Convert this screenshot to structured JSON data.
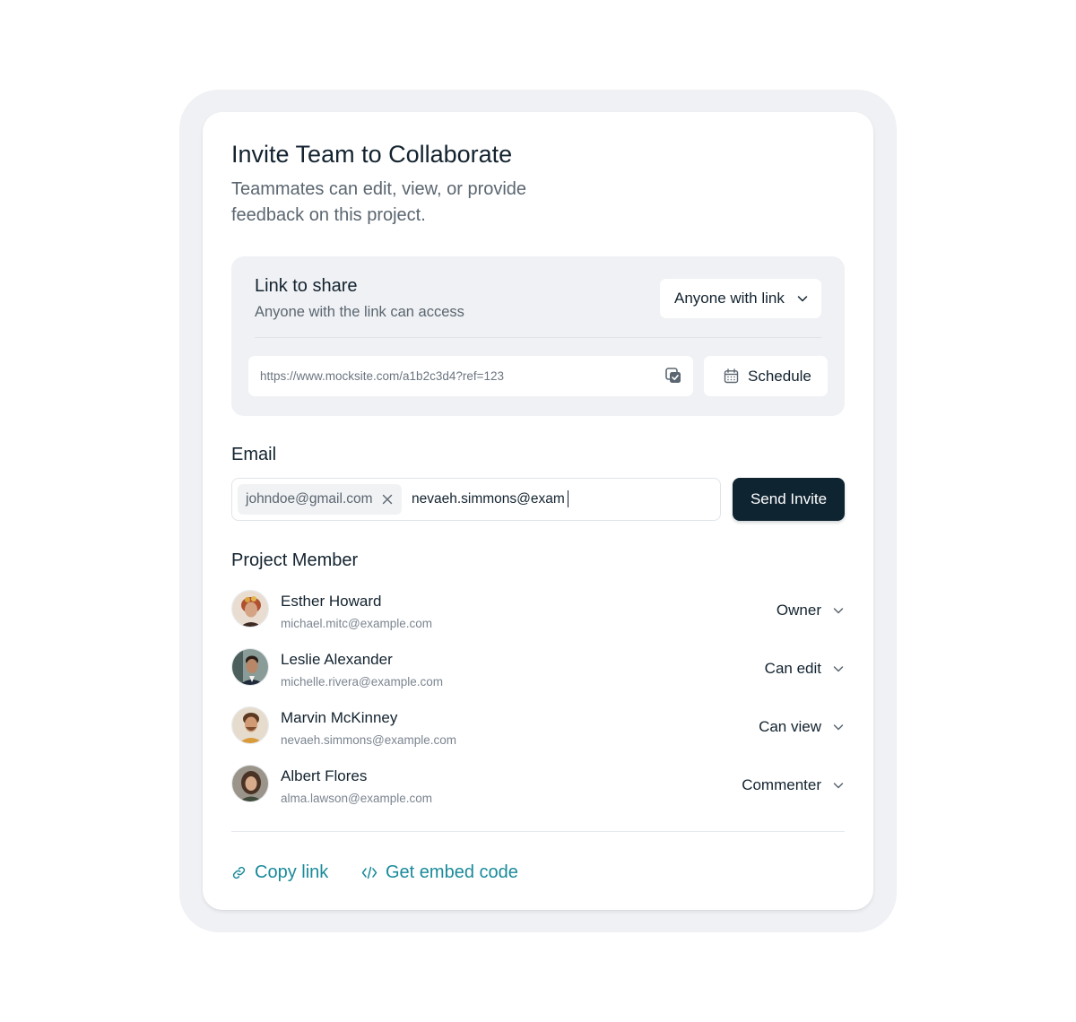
{
  "dialog": {
    "title": "Invite Team to Collaborate",
    "subtitle": "Teammates can edit, view, or provide feedback on this project."
  },
  "share": {
    "title": "Link to share",
    "subtitle": "Anyone with the link can access",
    "access_value": "Anyone with link",
    "url": "https://www.mocksite.com/a1b2c3d4?ref=123",
    "schedule_label": "Schedule"
  },
  "email": {
    "label": "Email",
    "chip": "johndoe@gmail.com",
    "input_value": "nevaeh.simmons@exam",
    "send_label": "Send Invite"
  },
  "members": {
    "label": "Project Member",
    "items": [
      {
        "name": "Esther Howard",
        "email": "michael.mitc@example.com",
        "role": "Owner"
      },
      {
        "name": "Leslie Alexander",
        "email": "michelle.rivera@example.com",
        "role": "Can edit"
      },
      {
        "name": "Marvin McKinney",
        "email": "nevaeh.simmons@example.com",
        "role": "Can view"
      },
      {
        "name": "Albert Flores",
        "email": "alma.lawson@example.com",
        "role": "Commenter"
      }
    ]
  },
  "footer": {
    "copy_link": "Copy link",
    "embed_code": "Get embed code"
  },
  "colors": {
    "primary_button": "#0f2431",
    "link": "#1a8a9a",
    "panel": "#eff1f4"
  },
  "icons": [
    "chevron-down-icon",
    "copy-icon",
    "calendar-icon",
    "close-icon",
    "link-icon",
    "code-icon"
  ]
}
